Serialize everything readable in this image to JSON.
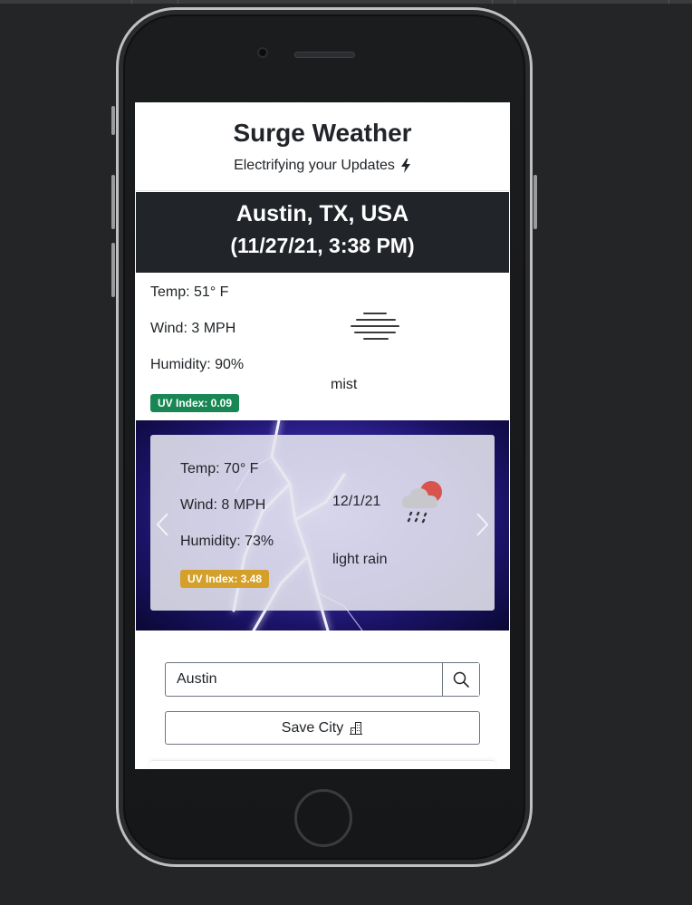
{
  "app": {
    "title": "Surge Weather",
    "tagline": "Electrifying your Updates"
  },
  "current": {
    "city": "Austin, TX, USA",
    "datetime": "(11/27/21, 3:38 PM)",
    "temp": "Temp: 51° F",
    "wind": "Wind: 3 MPH",
    "humidity": "Humidity: 90%",
    "uv": "UV Index: 0.09",
    "uv_color": "#198754",
    "description": "mist",
    "icon": "mist-icon"
  },
  "forecast": {
    "temp": "Temp: 70° F",
    "wind": "Wind: 8 MPH",
    "humidity": "Humidity: 73%",
    "uv": "UV Index: 3.48",
    "uv_color": "#d4a02a",
    "date": "12/1/21",
    "description": "light rain",
    "icon": "cloud-sun-rain-icon"
  },
  "search": {
    "value": "Austin"
  },
  "save_button": {
    "label": "Save City"
  },
  "colors": {
    "banner": "#212529",
    "background": "#242526"
  }
}
